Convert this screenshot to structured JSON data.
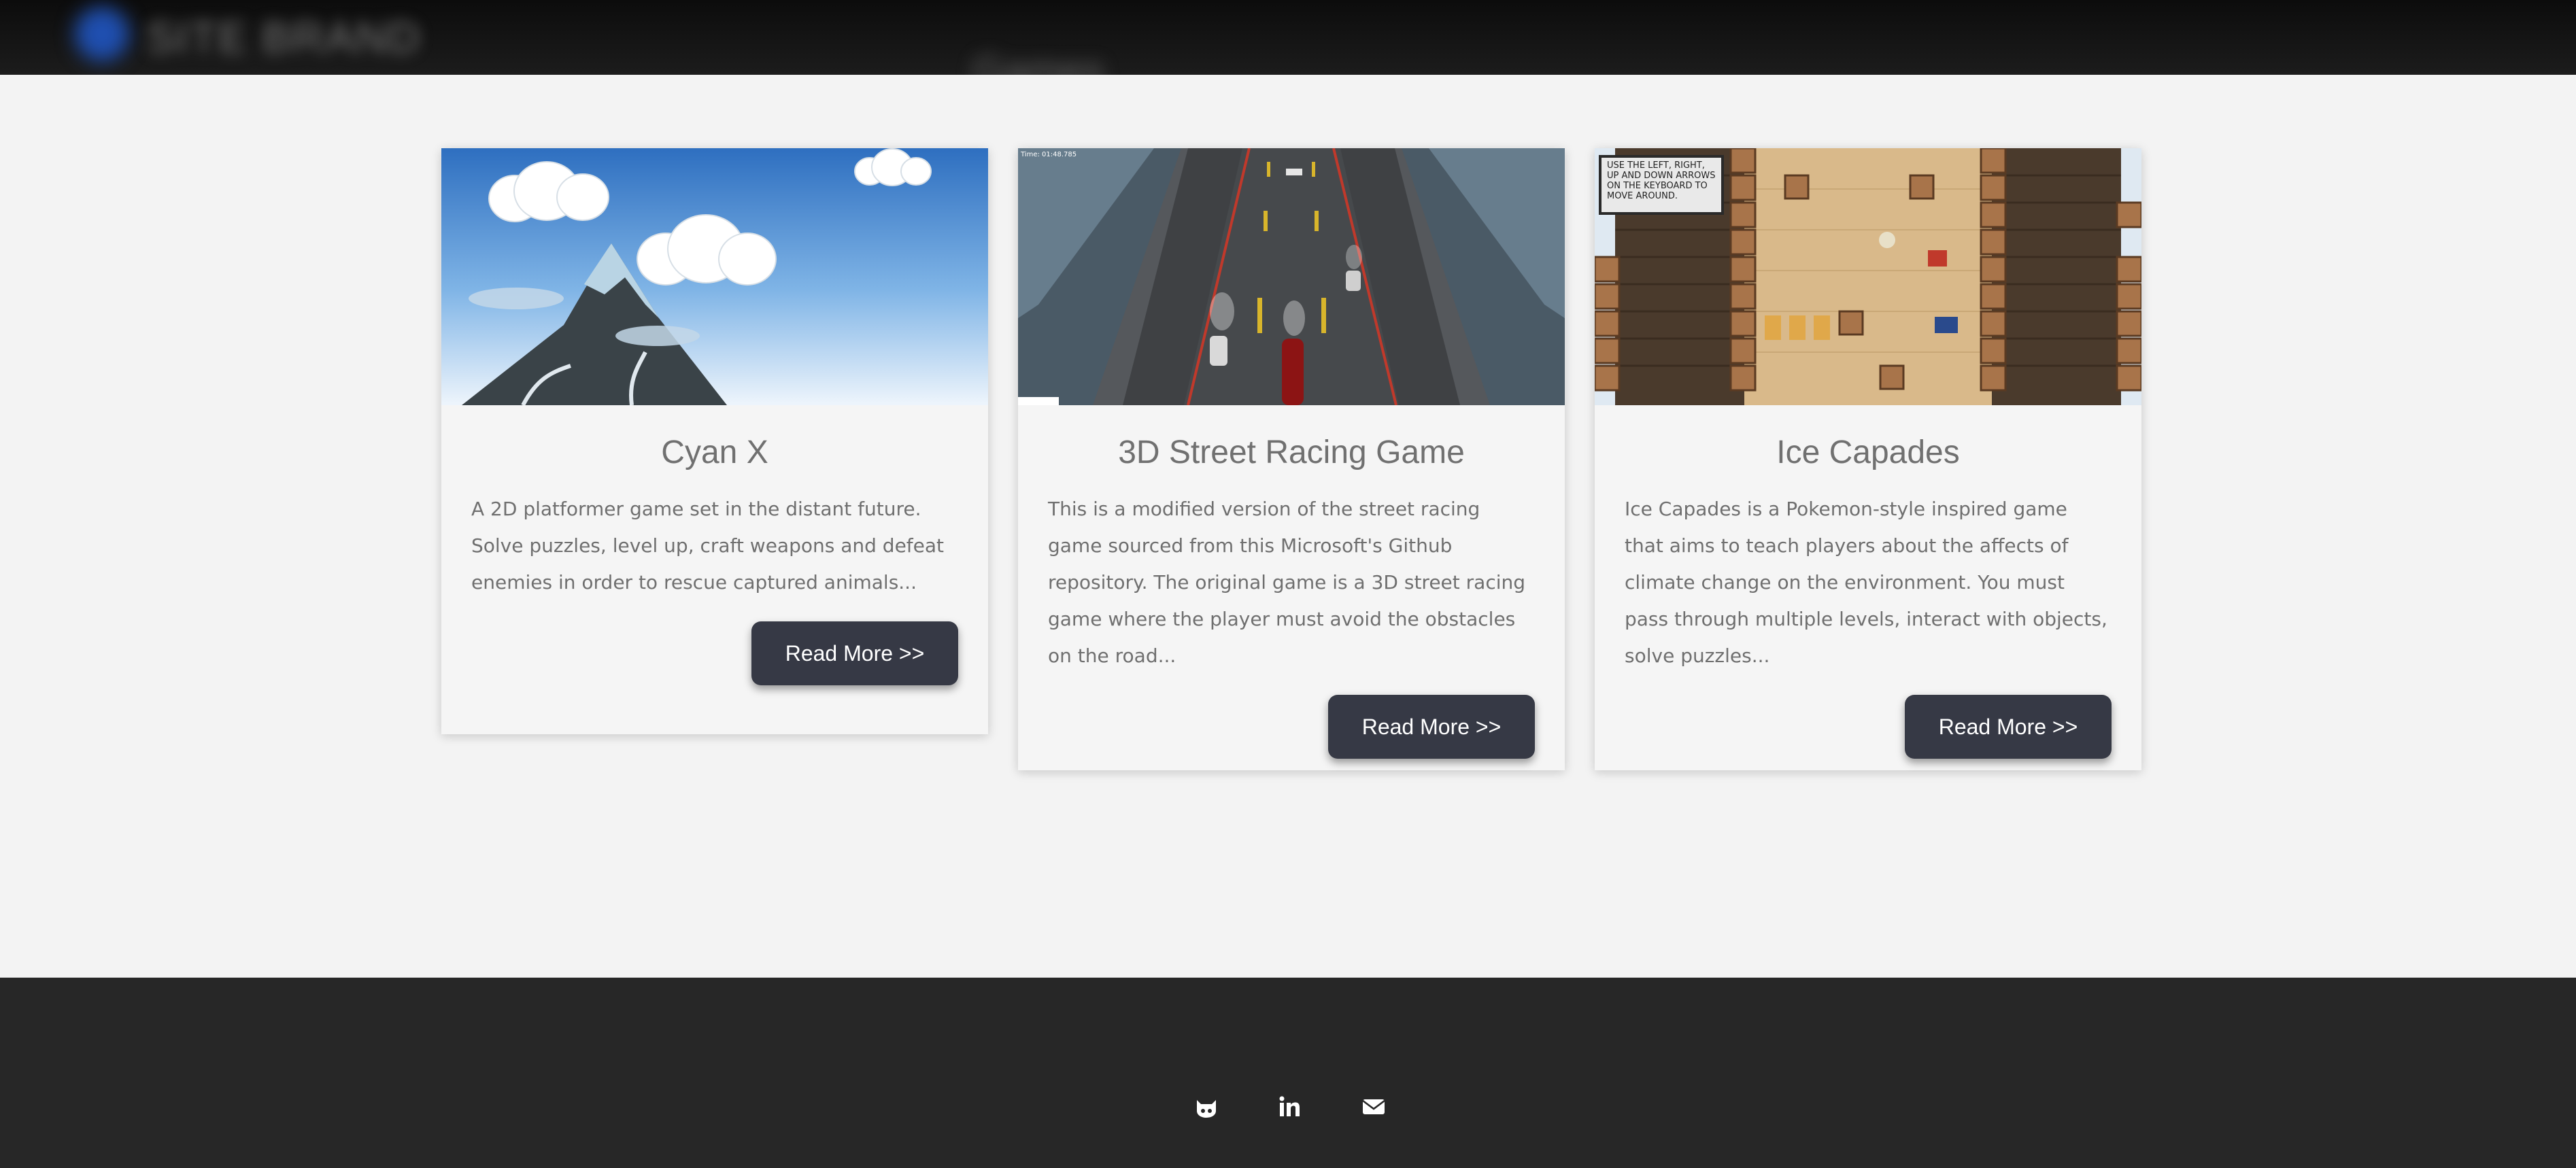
{
  "header": {
    "brand": "SITE BRAND",
    "ghost_text": "Games"
  },
  "cards": [
    {
      "title": "Cyan X",
      "description": "A 2D platformer game set in the distant future. Solve puzzles, level up, craft weapons and defeat enemies in order to rescue captured animals...",
      "button_label": "Read More >>",
      "thumbnail": "mountain-clouds-thumbnail"
    },
    {
      "title": "3D Street Racing Game",
      "description": "This is a modified version of the street racing game sourced from this Microsoft's Github repository. The original game is a 3D street racing game where the player must avoid the obstacles on the road...",
      "button_label": "Read More >>",
      "thumbnail": "street-racing-thumbnail",
      "thumbnail_overlay": "Time: 01:48.785"
    },
    {
      "title": "Ice Capades",
      "description": "Ice Capades is a Pokemon-style inspired game that aims to teach players about the affects of climate change on the environment. You must pass through multiple levels, interact with objects, solve puzzles...",
      "button_label": "Read More >>",
      "thumbnail": "ice-capades-thumbnail",
      "thumbnail_overlay": "USE THE LEFT, RIGHT, UP AND DOWN ARROWS ON THE KEYBOARD TO MOVE AROUND."
    }
  ],
  "footer": {
    "social": [
      {
        "icon": "github-icon"
      },
      {
        "icon": "linkedin-icon"
      },
      {
        "icon": "email-icon"
      }
    ]
  },
  "colors": {
    "button_bg": "#363945",
    "footer_bg": "#272727",
    "page_bg": "#f3f3f3"
  }
}
